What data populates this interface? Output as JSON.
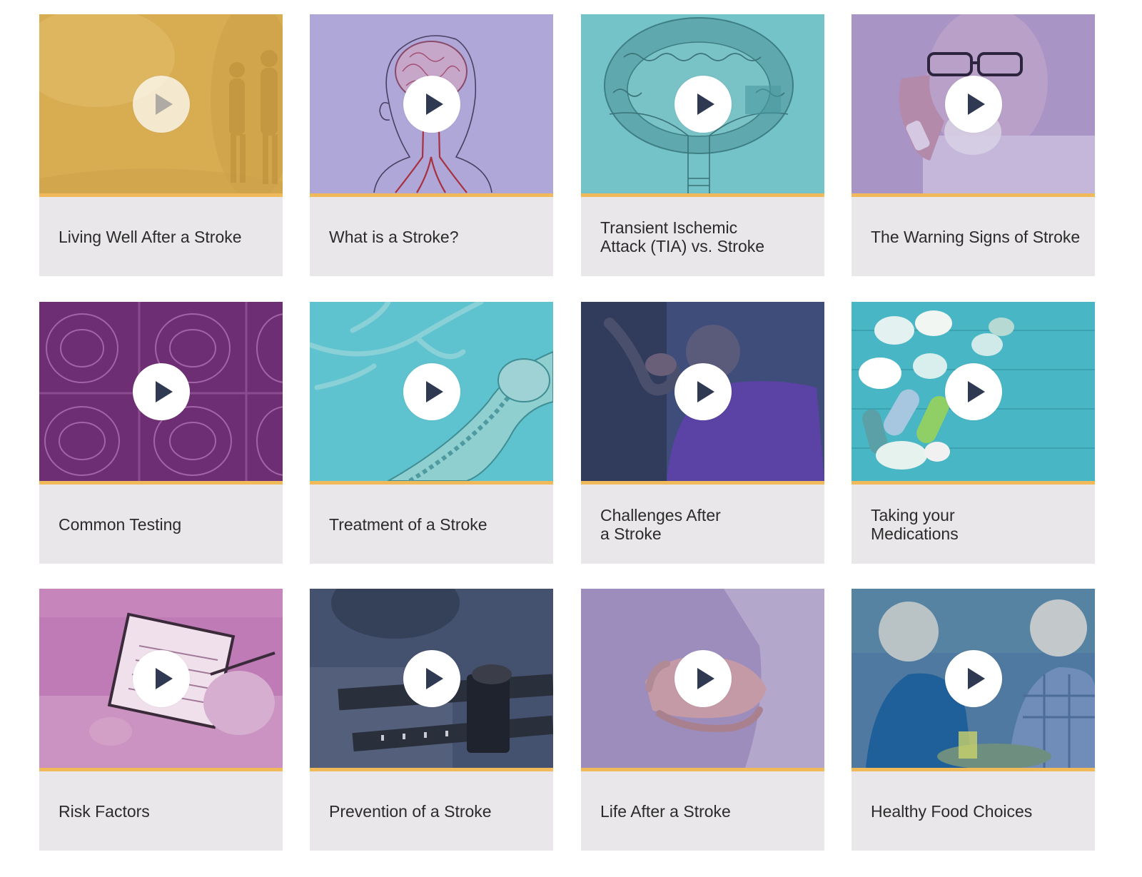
{
  "videos": [
    {
      "title": "Living Well After a Stroke",
      "thumb_color": "#d8ad52",
      "thumb_icon": "couple-walking-photo"
    },
    {
      "title": "What is a Stroke?",
      "thumb_color": "#aea7d8",
      "thumb_icon": "brain-anatomy-illustration"
    },
    {
      "title": "Transient Ischemic\nAttack (TIA) vs. Stroke",
      "thumb_color": "#73c3c8",
      "thumb_icon": "brain-cross-section-illustration"
    },
    {
      "title": "The Warning Signs of Stroke",
      "thumb_color": "#a994c6",
      "thumb_icon": "man-on-phone-photo"
    },
    {
      "title": "Common Testing",
      "thumb_color": "#6e2e73",
      "thumb_icon": "brain-scan-images"
    },
    {
      "title": "Treatment of a Stroke",
      "thumb_color": "#5fc3cf",
      "thumb_icon": "artery-illustration"
    },
    {
      "title": "Challenges After\na Stroke",
      "thumb_color": "#3e4d7a",
      "thumb_icon": "handshake-photo"
    },
    {
      "title": "Taking your\nMedications",
      "thumb_color": "#48b6c4",
      "thumb_icon": "pills-photo"
    },
    {
      "title": "Risk Factors",
      "thumb_color": "#bf7bb5",
      "thumb_icon": "clipboard-photo"
    },
    {
      "title": "Prevention of a Stroke",
      "thumb_color": "#44516f",
      "thumb_icon": "scale-photo"
    },
    {
      "title": "Life After a Stroke",
      "thumb_color": "#9d8dbd",
      "thumb_icon": "holding-hands-photo"
    },
    {
      "title": "Healthy Food Choices",
      "thumb_color": "#4f79a0",
      "thumb_icon": "couple-eating-photo"
    }
  ],
  "colors": {
    "card_background": "#e9e7e9",
    "accent_bar": "#f0b95a",
    "play_triangle": "#2f3a52",
    "title_text": "#2b2b2b"
  }
}
